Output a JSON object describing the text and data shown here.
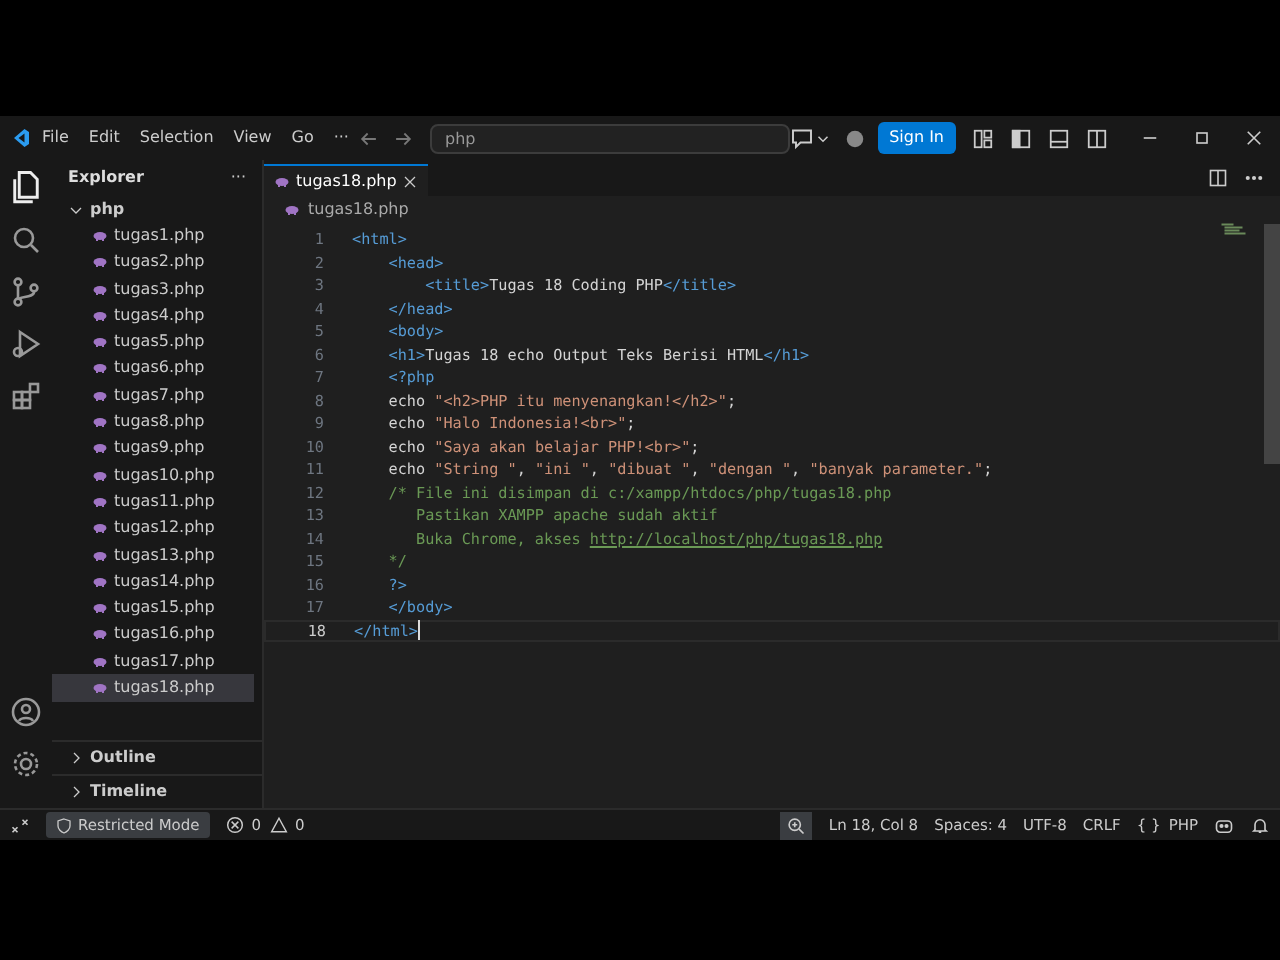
{
  "menu": [
    "File",
    "Edit",
    "Selection",
    "View",
    "Go",
    "···"
  ],
  "command_center": {
    "value": "php"
  },
  "sign_in": "Sign In",
  "explorer": {
    "title": "Explorer",
    "more": "···",
    "folder": {
      "label": "php",
      "expanded": true,
      "children": [
        {
          "label": "tugas1.php",
          "selected": false
        },
        {
          "label": "tugas2.php",
          "selected": false
        },
        {
          "label": "tugas3.php",
          "selected": false
        },
        {
          "label": "tugas4.php",
          "selected": false
        },
        {
          "label": "tugas5.php",
          "selected": false
        },
        {
          "label": "tugas6.php",
          "selected": false
        },
        {
          "label": "tugas7.php",
          "selected": false
        },
        {
          "label": "tugas8.php",
          "selected": false
        },
        {
          "label": "tugas9.php",
          "selected": false
        },
        {
          "label": "tugas10.php",
          "selected": false
        },
        {
          "label": "tugas11.php",
          "selected": false
        },
        {
          "label": "tugas12.php",
          "selected": false
        },
        {
          "label": "tugas13.php",
          "selected": false
        },
        {
          "label": "tugas14.php",
          "selected": false
        },
        {
          "label": "tugas15.php",
          "selected": false
        },
        {
          "label": "tugas16.php",
          "selected": false
        },
        {
          "label": "tugas17.php",
          "selected": false
        },
        {
          "label": "tugas18.php",
          "selected": true
        }
      ]
    },
    "sections": [
      {
        "label": "Outline",
        "expanded": false
      },
      {
        "label": "Timeline",
        "expanded": false
      }
    ]
  },
  "tabs": [
    {
      "label": "tugas18.php",
      "selected": true
    }
  ],
  "breadcrumb": "tugas18.php",
  "code": [
    {
      "number": "1",
      "current": false,
      "segments": [
        {
          "kind": "tag",
          "text": "<html>"
        }
      ]
    },
    {
      "number": "2",
      "current": false,
      "segments": [
        {
          "kind": "tag",
          "text": "    <head>"
        }
      ]
    },
    {
      "number": "3",
      "current": false,
      "segments": [
        {
          "kind": "tag",
          "text": "        <title>"
        },
        {
          "kind": "text",
          "text": "Tugas 18 Coding PHP"
        },
        {
          "kind": "tag",
          "text": "</title>"
        }
      ]
    },
    {
      "number": "4",
      "current": false,
      "segments": [
        {
          "kind": "tag",
          "text": "    </head>"
        }
      ]
    },
    {
      "number": "5",
      "current": false,
      "segments": [
        {
          "kind": "tag",
          "text": "    <body>"
        }
      ]
    },
    {
      "number": "6",
      "current": false,
      "segments": [
        {
          "kind": "tag",
          "text": "    <h1>"
        },
        {
          "kind": "text",
          "text": "Tugas 18 echo Output Teks Berisi HTML"
        },
        {
          "kind": "tag",
          "text": "</h1>"
        }
      ]
    },
    {
      "number": "7",
      "current": false,
      "segments": [
        {
          "kind": "tag",
          "text": "    <?php"
        }
      ]
    },
    {
      "number": "8",
      "current": false,
      "segments": [
        {
          "kind": "text",
          "text": "    echo "
        },
        {
          "kind": "string",
          "text": "\"<h2>PHP itu menyenangkan!</h2>\""
        },
        {
          "kind": "text",
          "text": ";"
        }
      ]
    },
    {
      "number": "9",
      "current": false,
      "segments": [
        {
          "kind": "text",
          "text": "    echo "
        },
        {
          "kind": "string",
          "text": "\"Halo Indonesia!<br>\""
        },
        {
          "kind": "text",
          "text": ";"
        }
      ]
    },
    {
      "number": "10",
      "current": false,
      "segments": [
        {
          "kind": "text",
          "text": "    echo "
        },
        {
          "kind": "string",
          "text": "\"Saya akan belajar PHP!<br>\""
        },
        {
          "kind": "text",
          "text": ";"
        }
      ]
    },
    {
      "number": "11",
      "current": false,
      "segments": [
        {
          "kind": "text",
          "text": "    echo "
        },
        {
          "kind": "string",
          "text": "\"String \""
        },
        {
          "kind": "text",
          "text": ", "
        },
        {
          "kind": "string",
          "text": "\"ini \""
        },
        {
          "kind": "text",
          "text": ", "
        },
        {
          "kind": "string",
          "text": "\"dibuat \""
        },
        {
          "kind": "text",
          "text": ", "
        },
        {
          "kind": "string",
          "text": "\"dengan \""
        },
        {
          "kind": "text",
          "text": ", "
        },
        {
          "kind": "string",
          "text": "\"banyak parameter.\""
        },
        {
          "kind": "text",
          "text": ";"
        }
      ]
    },
    {
      "number": "12",
      "current": false,
      "segments": [
        {
          "kind": "comment",
          "text": "    /* File ini disimpan di c:/xampp/htdocs/php/tugas18.php"
        }
      ]
    },
    {
      "number": "13",
      "current": false,
      "segments": [
        {
          "kind": "comment",
          "text": "       Pastikan XAMPP apache sudah aktif"
        }
      ]
    },
    {
      "number": "14",
      "current": false,
      "segments": [
        {
          "kind": "comment",
          "text": "       Buka Chrome, akses "
        },
        {
          "kind": "link",
          "text": "http://localhost/php/tugas18.php"
        }
      ]
    },
    {
      "number": "15",
      "current": false,
      "segments": [
        {
          "kind": "comment",
          "text": "    */"
        }
      ]
    },
    {
      "number": "16",
      "current": false,
      "segments": [
        {
          "kind": "tag",
          "text": "    ?>"
        }
      ]
    },
    {
      "number": "17",
      "current": false,
      "segments": [
        {
          "kind": "tag",
          "text": "    </body>"
        }
      ]
    },
    {
      "number": "18",
      "current": true,
      "segments": [
        {
          "kind": "tag",
          "text": "</html>"
        }
      ]
    }
  ],
  "status_bar": {
    "restricted": "Restricted Mode",
    "errors": "0",
    "warnings": "0",
    "position": "Ln 18, Col 8",
    "spaces": "Spaces: 4",
    "encoding": "UTF-8",
    "eol": "CRLF",
    "braces": "{ }",
    "language": "PHP"
  }
}
